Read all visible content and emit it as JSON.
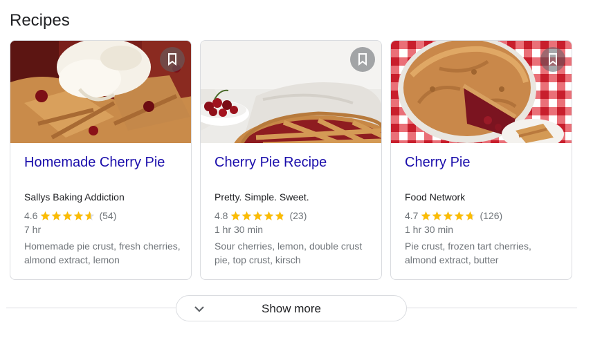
{
  "section": {
    "title": "Recipes"
  },
  "cards": [
    {
      "title": "Homemade Cherry Pie",
      "source": "Sallys Baking Addiction",
      "rating": "4.6",
      "rating_value": 4.6,
      "reviews": "(54)",
      "time": "7 hr",
      "ingredients": "Homemade pie crust, fresh cherries, almond extract, lemon",
      "save_icon": "bookmark-icon"
    },
    {
      "title": "Cherry Pie Recipe",
      "source": "Pretty. Simple. Sweet.",
      "rating": "4.8",
      "rating_value": 4.8,
      "reviews": "(23)",
      "time": "1 hr 30 min",
      "ingredients": "Sour cherries, lemon, double crust pie, top crust, kirsch",
      "save_icon": "bookmark-icon"
    },
    {
      "title": "Cherry Pie",
      "source": "Food Network",
      "rating": "4.7",
      "rating_value": 4.7,
      "reviews": "(126)",
      "time": "1 hr 30 min",
      "ingredients": "Pie crust, frozen tart cherries, almond extract, butter",
      "save_icon": "bookmark-icon"
    }
  ],
  "show_more": {
    "label": "Show more",
    "icon": "chevron-down-icon"
  },
  "colors": {
    "link": "#1a0dab",
    "star": "#fbbc04",
    "star_empty": "#dadce0",
    "secondary_text": "#70757a",
    "border": "#dadce0"
  }
}
